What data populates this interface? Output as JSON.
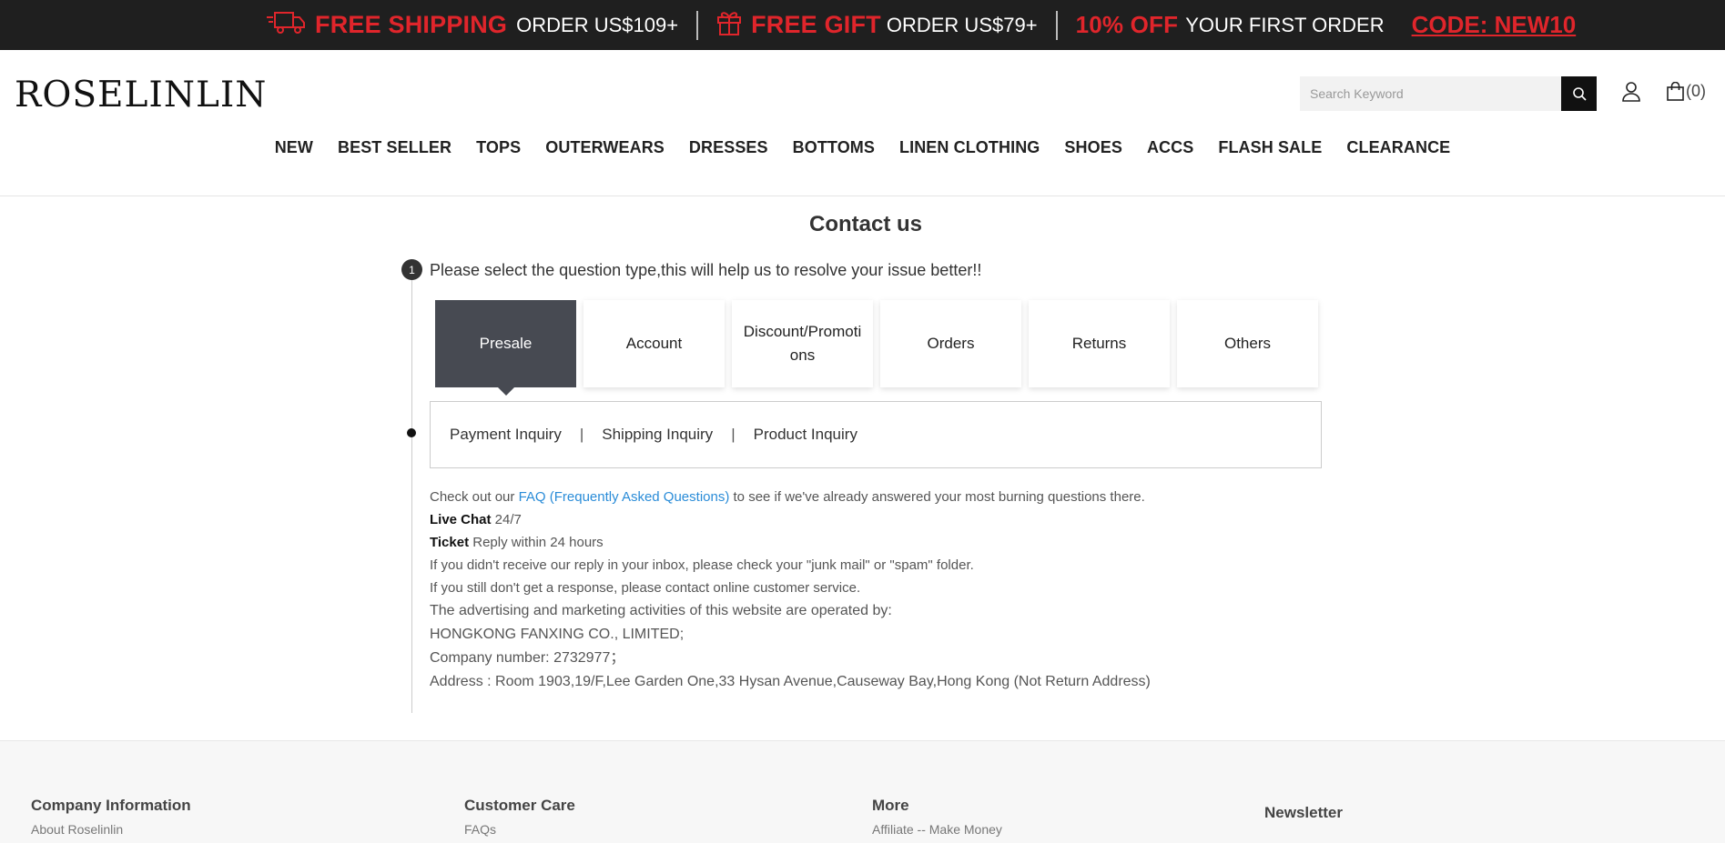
{
  "promo": {
    "shipping_title": "FREE SHIPPING",
    "shipping_text": "ORDER US$109+",
    "gift_title": "FREE GIFT",
    "gift_text": "ORDER US$79+",
    "off_title": "10% OFF",
    "off_text": "YOUR FIRST ORDER",
    "code": "CODE: NEW10",
    "accent_color": "#e0252b"
  },
  "header": {
    "logo": "ROSELINLIN",
    "search_placeholder": "Search Keyword",
    "cart_count": "(0)"
  },
  "nav": [
    "NEW",
    "BEST SELLER",
    "TOPS",
    "OUTERWEARS",
    "DRESSES",
    "BOTTOMS",
    "LINEN CLOTHING",
    "SHOES",
    "ACCS",
    "FLASH SALE",
    "CLEARANCE"
  ],
  "contact": {
    "title": "Contact us",
    "step_number": "1",
    "step_title": "Please select the question type,this will help us to resolve your issue better!!",
    "types": [
      "Presale",
      "Account",
      "Discount/Promotions",
      "Orders",
      "Returns",
      "Others"
    ],
    "active_type": "Presale",
    "subtypes": [
      "Payment Inquiry",
      "Shipping Inquiry",
      "Product Inquiry"
    ],
    "faq_prefix": "Check out our ",
    "faq_link": "FAQ (Frequently Asked Questions)",
    "faq_suffix": " to see if we've already answered your most burning questions there.",
    "live_chat_label": "Live Chat",
    "live_chat_value": " 24/7",
    "ticket_label": "Ticket",
    "ticket_value": " Reply within 24 hours",
    "junk_note": "If you didn't receive our reply in your inbox, please check your \"junk mail\" or \"spam\" folder.",
    "response_note": "If you still don't get a response, please contact online customer service.",
    "operated_by": "The advertising and marketing activities of this website are operated by:",
    "company": "HONGKONG FANXING CO., LIMITED;",
    "company_number": "Company number: 2732977；",
    "address": "Address : Room 1903,19/F,Lee Garden One,33 Hysan Avenue,Causeway Bay,Hong Kong (Not Return Address)"
  },
  "footer": {
    "col1_title": "Company Information",
    "col1_link": "About Roselinlin",
    "col2_title": "Customer Care",
    "col2_link": "FAQs",
    "col3_title": "More",
    "col3_link": "Affiliate -- Make Money",
    "col4_title": "Newsletter"
  }
}
